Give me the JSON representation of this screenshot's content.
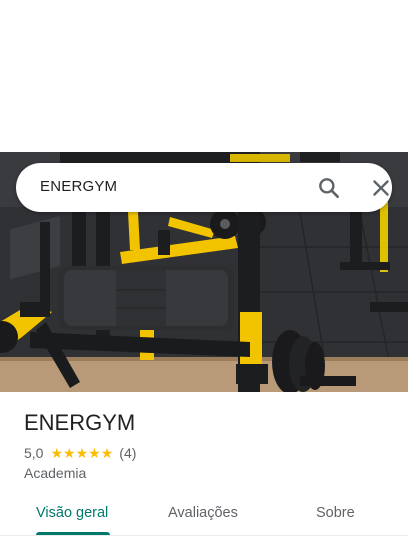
{
  "search": {
    "query": "ENERGYM",
    "search_icon": "search-icon",
    "close_icon": "close-icon"
  },
  "place": {
    "photo": "gym-interior-photo",
    "name": "ENERGYM",
    "rating": "5,0",
    "rating_stars": 5,
    "reviews_count": "(4)",
    "category": "Academia"
  },
  "tabs": [
    {
      "label": "Visão geral",
      "active": true
    },
    {
      "label": "Avaliações",
      "active": false
    },
    {
      "label": "Sobre",
      "active": false
    }
  ],
  "colors": {
    "accent": "#00796b",
    "star": "#fbbc04",
    "equipment_yellow": "#f2c400"
  }
}
